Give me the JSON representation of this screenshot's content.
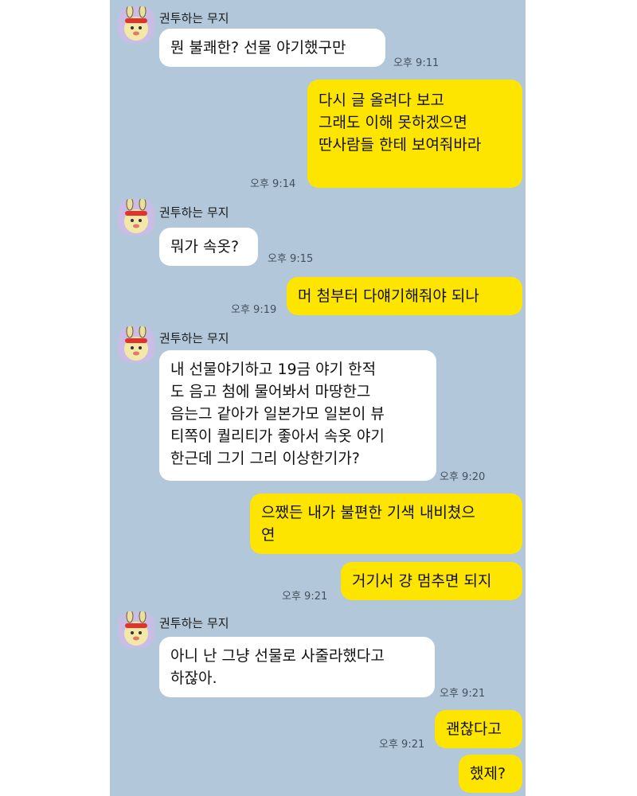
{
  "chat": {
    "messages": [
      {
        "sender": "권투하는 무지",
        "text": "뭔 불쾌한? 선물 야기했구만",
        "time": "오후 9:11"
      },
      {
        "text": "다시 글 올려다 보고\n그래도 이해 못하겠으면\n딴사람들 한테 보여줘바라",
        "time": "오후 9:14"
      },
      {
        "sender": "권투하는 무지",
        "text": "뭐가 속옷?",
        "time": "오후 9:15"
      },
      {
        "text": "머 첨부터 다얘기해줘야 되나",
        "time": "오후 9:19"
      },
      {
        "sender": "권투하는 무지",
        "text": "내 선물야기하고 19금 야기 한적\n도 음고 첨에 물어봐서 마땅한그\n음는그 같아가 일본가모 일본이 뷰\n티쪽이 퀄리티가 좋아서 속옷 야기\n한근데 그기 그리 이상한기가?",
        "time": "오후 9:20"
      },
      {
        "text": "으쨌든 내가 불편한 기색 내비쳤으\n연"
      },
      {
        "text": "거기서 걍 멈추면 되지",
        "time": "오후 9:21"
      },
      {
        "sender": "권투하는 무지",
        "text": "아니 난 그냥 선물로 사줄라했다고\n하잖아.",
        "time": "오후 9:21"
      },
      {
        "text": "괜찮다고",
        "time": "오후 9:21"
      },
      {
        "text": "했제?"
      }
    ]
  },
  "colors": {
    "background": "#b2c7da",
    "incoming_bubble": "#ffffff",
    "outgoing_bubble": "#fee500"
  }
}
